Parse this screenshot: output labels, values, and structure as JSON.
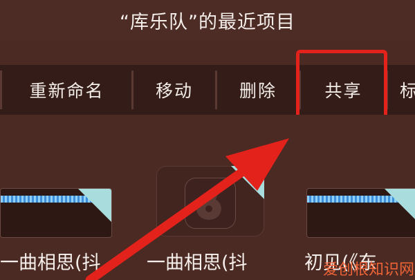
{
  "header": {
    "title": "“库乐队”的最近项目"
  },
  "menu": {
    "items": [
      {
        "label": "重新命名"
      },
      {
        "label": "移动"
      },
      {
        "label": "删除"
      },
      {
        "label": "共享"
      },
      {
        "label": "标"
      }
    ]
  },
  "files": [
    {
      "label": "一曲相思(抖"
    },
    {
      "label": "一曲相思(抖"
    },
    {
      "label": "初见(《东"
    }
  ],
  "watermark": {
    "text": "爱创根知识网"
  },
  "colors": {
    "highlight": "#e3221c",
    "arrow": "#e3221c",
    "background": "#4a2a22",
    "menu": "#341d18"
  },
  "icons": [
    "garageband-guitar-icon",
    "cloud-icon",
    "waveform-icon"
  ]
}
